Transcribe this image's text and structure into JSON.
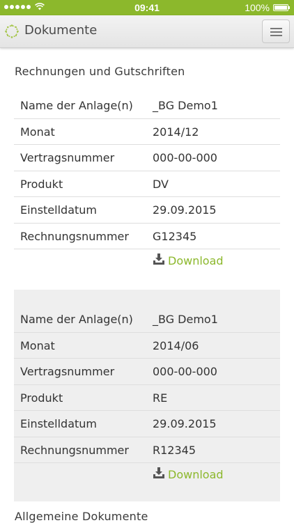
{
  "status_bar": {
    "time": "09:41",
    "battery_percent": "100%",
    "signal_dots": 5,
    "battery_level": 1.0
  },
  "header": {
    "title": "Dokumente",
    "menu_icon": "hamburger-menu-icon",
    "logo_icon": "dotted-ring-logo"
  },
  "sections": {
    "invoices_title": "Rechnungen und Gutschriften",
    "general_title": "Allgemeine Dokumente"
  },
  "documents": [
    {
      "rows": [
        {
          "label": "Name der Anlage(n)",
          "value": "_BG Demo1"
        },
        {
          "label": "Monat",
          "value": "2014/12"
        },
        {
          "label": "Vertragsnummer",
          "value": "000-00-000"
        },
        {
          "label": "Produkt",
          "value": "DV"
        },
        {
          "label": "Einstelldatum",
          "value": "29.09.2015"
        },
        {
          "label": "Rechnungsnummer",
          "value": "G12345"
        }
      ],
      "download_label": "Download"
    },
    {
      "rows": [
        {
          "label": "Name der Anlage(n)",
          "value": "_BG Demo1"
        },
        {
          "label": "Monat",
          "value": "2014/06"
        },
        {
          "label": "Vertragsnummer",
          "value": "000-00-000"
        },
        {
          "label": "Produkt",
          "value": "RE"
        },
        {
          "label": "Einstelldatum",
          "value": "29.09.2015"
        },
        {
          "label": "Rechnungsnummer",
          "value": "R12345"
        }
      ],
      "download_label": "Download"
    }
  ],
  "colors": {
    "accent": "#8cb82c",
    "header_bg": "#ececec",
    "shaded_card": "#efefef"
  }
}
